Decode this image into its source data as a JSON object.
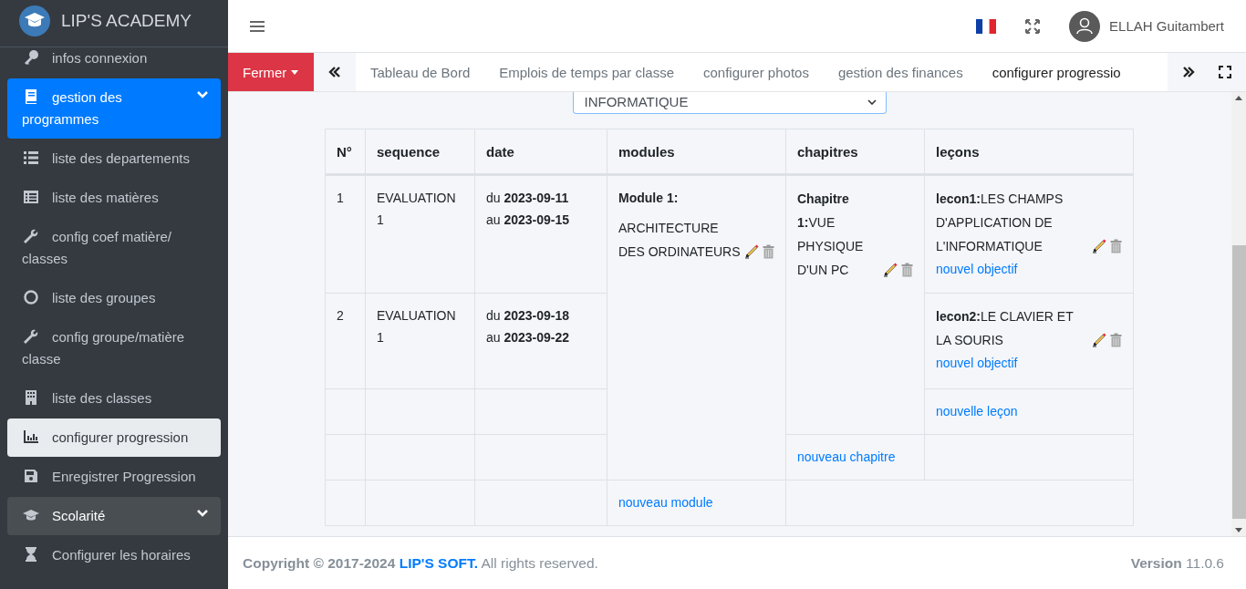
{
  "sidebar": {
    "brand": "LIP'S ACADEMY",
    "items": [
      {
        "label": "infos connexion",
        "kind": "link",
        "selected": false
      },
      {
        "label": "gestion des programmes",
        "kind": "group",
        "selected": true
      },
      {
        "label": "liste des departements",
        "kind": "link",
        "selected": false
      },
      {
        "label": "liste des matières",
        "kind": "link",
        "selected": false
      },
      {
        "label": "config coef matière/ classes",
        "kind": "link",
        "selected": false
      },
      {
        "label": "liste des groupes",
        "kind": "link",
        "selected": false
      },
      {
        "label": "config groupe/matière classe",
        "kind": "link",
        "selected": false
      },
      {
        "label": "liste des classes",
        "kind": "link",
        "selected": false
      },
      {
        "label": "configurer progression",
        "kind": "link",
        "selected": true
      },
      {
        "label": "Enregistrer Progression",
        "kind": "link",
        "selected": false
      },
      {
        "label": "Scolarité",
        "kind": "group",
        "selected": false
      },
      {
        "label": "Configurer les horaires",
        "kind": "link",
        "selected": false
      }
    ]
  },
  "topbar": {
    "user": "ELLAH Guitambert"
  },
  "tabbar": {
    "close_button": "Fermer",
    "tabs": [
      {
        "label": "Tableau de Bord",
        "selected": false
      },
      {
        "label": "Emplois de temps par classe",
        "selected": false
      },
      {
        "label": "configurer photos",
        "selected": false
      },
      {
        "label": "gestion des finances",
        "selected": false
      },
      {
        "label": "configurer progressio",
        "selected": true
      }
    ]
  },
  "filter": {
    "value": "INFORMATIQUE"
  },
  "table": {
    "columns": [
      "N°",
      "sequence",
      "date",
      "modules",
      "chapitres",
      "leçons"
    ],
    "sequences": [
      {
        "number": "1",
        "name": "EVALUATION 1",
        "from": "du **2023-09-11**",
        "to": "au **2023-09-15**"
      },
      {
        "number": "2",
        "name": "EVALUATION 1",
        "from": "du **2023-09-18**",
        "to": "au **2023-09-22**"
      }
    ],
    "module": {
      "title": "Module 1:",
      "name": "ARCHITECTURE DES ORDINATEURS"
    },
    "chapter": "**Chapitre 1:**VUE PHYSIQUE D'UN PC",
    "lessons": [
      {
        "text": "**lecon1:**LES CHAMPS D'APPLICATION DE L'INFORMATIQUE",
        "link": "nouvel objectif"
      },
      {
        "text": "**lecon2:**LE CLAVIER ET LA SOURIS",
        "link": "nouvel objectif"
      }
    ],
    "new_lesson": "nouvelle leçon",
    "new_chapter": "nouveau chapitre",
    "new_module": "nouveau module"
  },
  "footer": {
    "copyright": "Copyright © 2017-2024",
    "company": "LIP'S SOFT.",
    "rights": "All rights reserved.",
    "version": "**Version** 11.0.6"
  }
}
